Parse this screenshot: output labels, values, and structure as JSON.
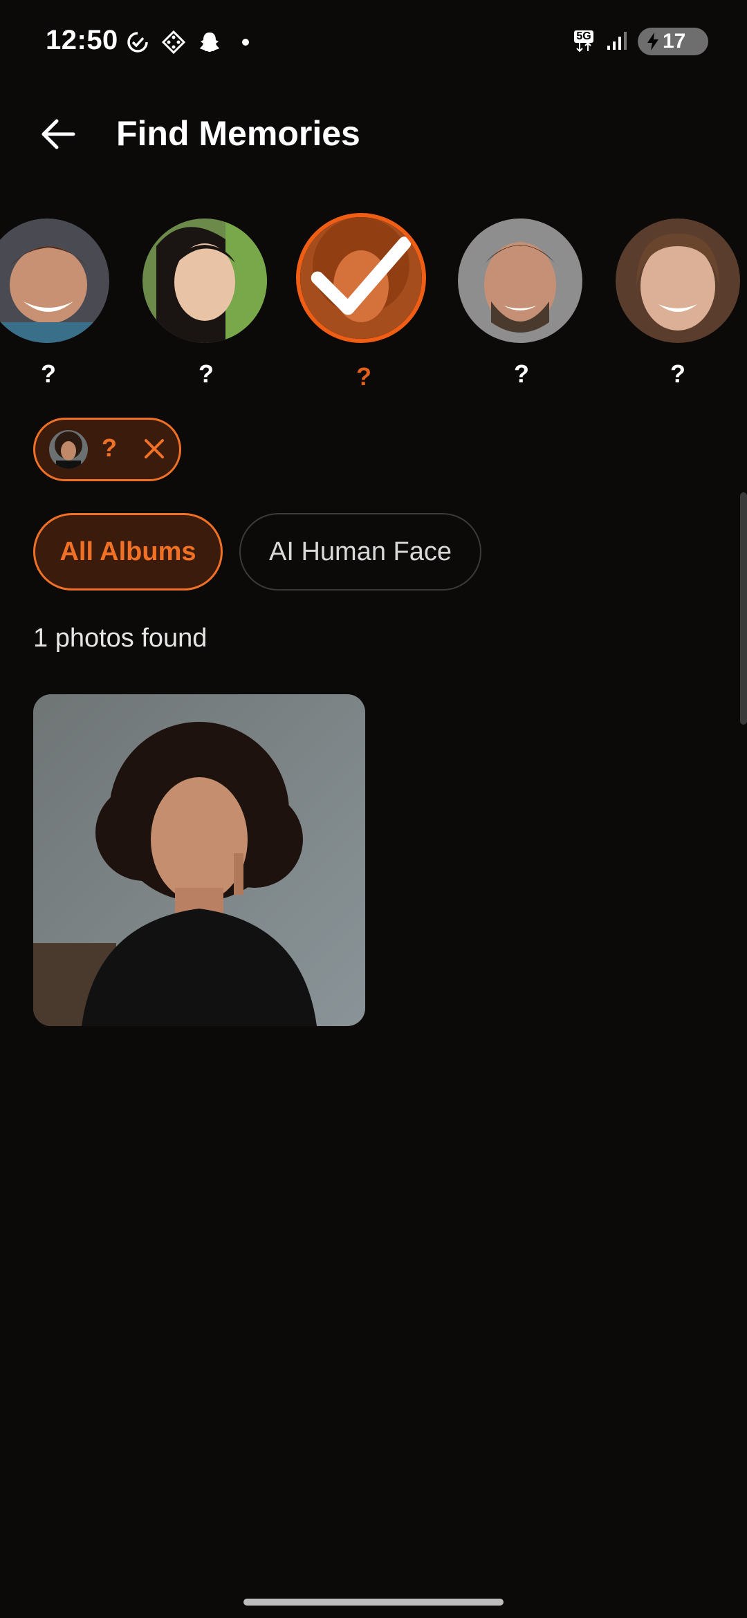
{
  "status_bar": {
    "time": "12:50",
    "network": "5G",
    "battery": "17",
    "icons": [
      "sync-check-icon",
      "game-controller-icon",
      "snapchat-ghost-icon",
      "notification-dot-icon",
      "5g-icon",
      "signal-icon",
      "battery-charging-icon"
    ]
  },
  "header": {
    "title": "Find Memories",
    "back_icon": "arrow-left-icon"
  },
  "faces": [
    {
      "label": "?",
      "selected": false
    },
    {
      "label": "?",
      "selected": false
    },
    {
      "label": "?",
      "selected": true
    },
    {
      "label": "?",
      "selected": false
    },
    {
      "label": "?",
      "selected": false
    }
  ],
  "selected_chip": {
    "label": "?",
    "remove_icon": "close-icon"
  },
  "filters": [
    {
      "label": "All Albums",
      "active": true
    },
    {
      "label": "AI Human Face",
      "active": false
    }
  ],
  "results": {
    "count_text": "1 photos found"
  },
  "colors": {
    "background": "#0b0a09",
    "accent": "#f07126",
    "accent_fill": "#3b1b0c",
    "text": "#ffffff"
  }
}
